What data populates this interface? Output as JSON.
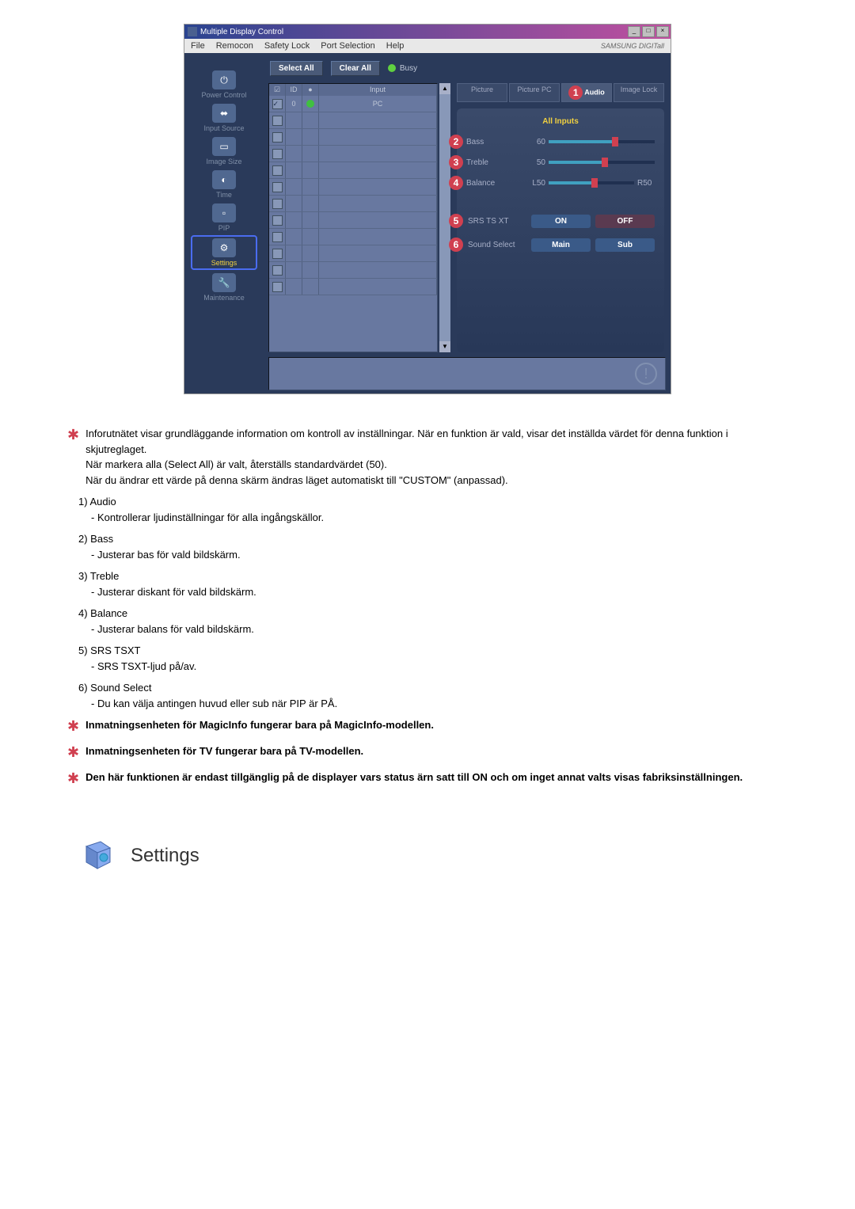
{
  "screenshot": {
    "title": "Multiple Display Control",
    "menu": {
      "file": "File",
      "remocon": "Remocon",
      "safety": "Safety Lock",
      "port": "Port Selection",
      "help": "Help"
    },
    "brand": "SAMSUNG DIGITall",
    "toolbar": {
      "select_all": "Select All",
      "clear_all": "Clear All",
      "busy": "Busy"
    },
    "sidebar": {
      "power": "Power Control",
      "input": "Input Source",
      "image": "Image Size",
      "time": "Time",
      "pip": "PIP",
      "settings": "Settings",
      "maintenance": "Maintenance"
    },
    "grid": {
      "cols": {
        "id": "ID",
        "input": "Input"
      },
      "row0_id": "0",
      "row0_input": "PC"
    },
    "tabs": {
      "picture": "Picture",
      "picture_pc": "Picture PC",
      "audio": "Audio",
      "image_lock": "Image Lock"
    },
    "panel": {
      "all_inputs": "All Inputs",
      "bass": "Bass",
      "bass_val": "60",
      "treble": "Treble",
      "treble_val": "50",
      "balance": "Balance",
      "balance_l": "L50",
      "balance_r": "R50",
      "srs": "SRS TS XT",
      "on": "ON",
      "off": "OFF",
      "sound_select": "Sound Select",
      "main": "Main",
      "sub": "Sub"
    },
    "markers": {
      "m1": "1",
      "m2": "2",
      "m3": "3",
      "m4": "4",
      "m5": "5",
      "m6": "6"
    }
  },
  "doc": {
    "note1a": "Inforutnätet visar grundläggande information om kontroll av inställningar. När en funktion är vald, visar det inställda värdet för denna funktion i skjutreglaget.",
    "note1b": "När markera alla (Select All) är valt, återställs standardvärdet (50).",
    "note1c": "När du ändrar ett värde på denna skärm ändras läget automatiskt till \"CUSTOM\" (anpassad).",
    "item1": "1) Audio",
    "item1d": "- Kontrollerar ljudinställningar för alla ingångskällor.",
    "item2": "2) Bass",
    "item2d": "- Justerar bas för vald bildskärm.",
    "item3": "3) Treble",
    "item3d": "- Justerar diskant för vald bildskärm.",
    "item4": "4) Balance",
    "item4d": "- Justerar balans för vald bildskärm.",
    "item5": "5) SRS TSXT",
    "item5d": "- SRS TSXT-ljud på/av.",
    "item6": "6) Sound Select",
    "item6d": "- Du kan välja antingen huvud eller sub när PIP är PÅ.",
    "note2": "Inmatningsenheten för MagicInfo fungerar bara på MagicInfo-modellen.",
    "note3": "Inmatningsenheten för TV fungerar bara på TV-modellen.",
    "note4": "Den här funktionen är endast tillgänglig på de displayer vars status ärn satt till ON och om inget annat valts visas fabriksinställningen.",
    "settings_title": "Settings"
  }
}
